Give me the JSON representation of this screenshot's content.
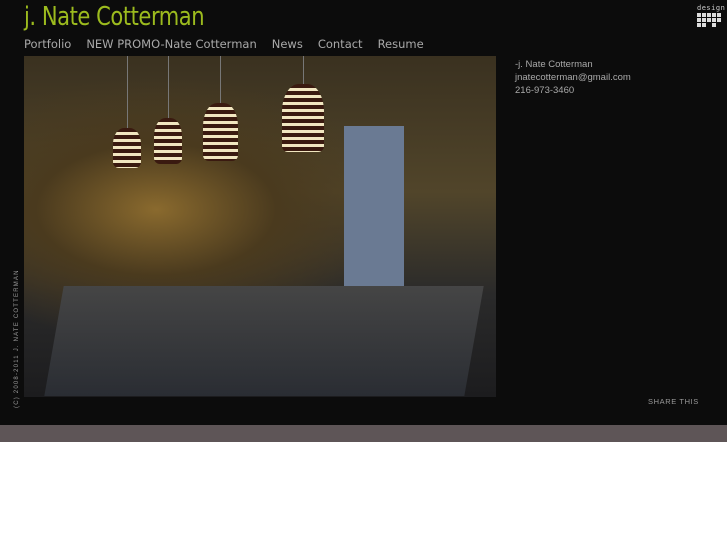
{
  "header": {
    "title": "j. Nate Cotterman"
  },
  "nav": [
    {
      "label": "Portfolio"
    },
    {
      "label": "NEW PROMO-Nate Cotterman"
    },
    {
      "label": "News"
    },
    {
      "label": "Contact"
    },
    {
      "label": "Resume"
    }
  ],
  "contact": {
    "name": "-j. Nate Cotterman",
    "email": "jnatecotterman@gmail.com",
    "phone": "216-973-3460"
  },
  "logo": {
    "text": "design"
  },
  "footer": {
    "copyright": "(C) 2008-2011 J. NATE COTTERMAN",
    "share": "SHARE THIS"
  },
  "colors": {
    "title": "#9cbb1e",
    "background": "#0c0c0c",
    "band": "#5e5557"
  }
}
